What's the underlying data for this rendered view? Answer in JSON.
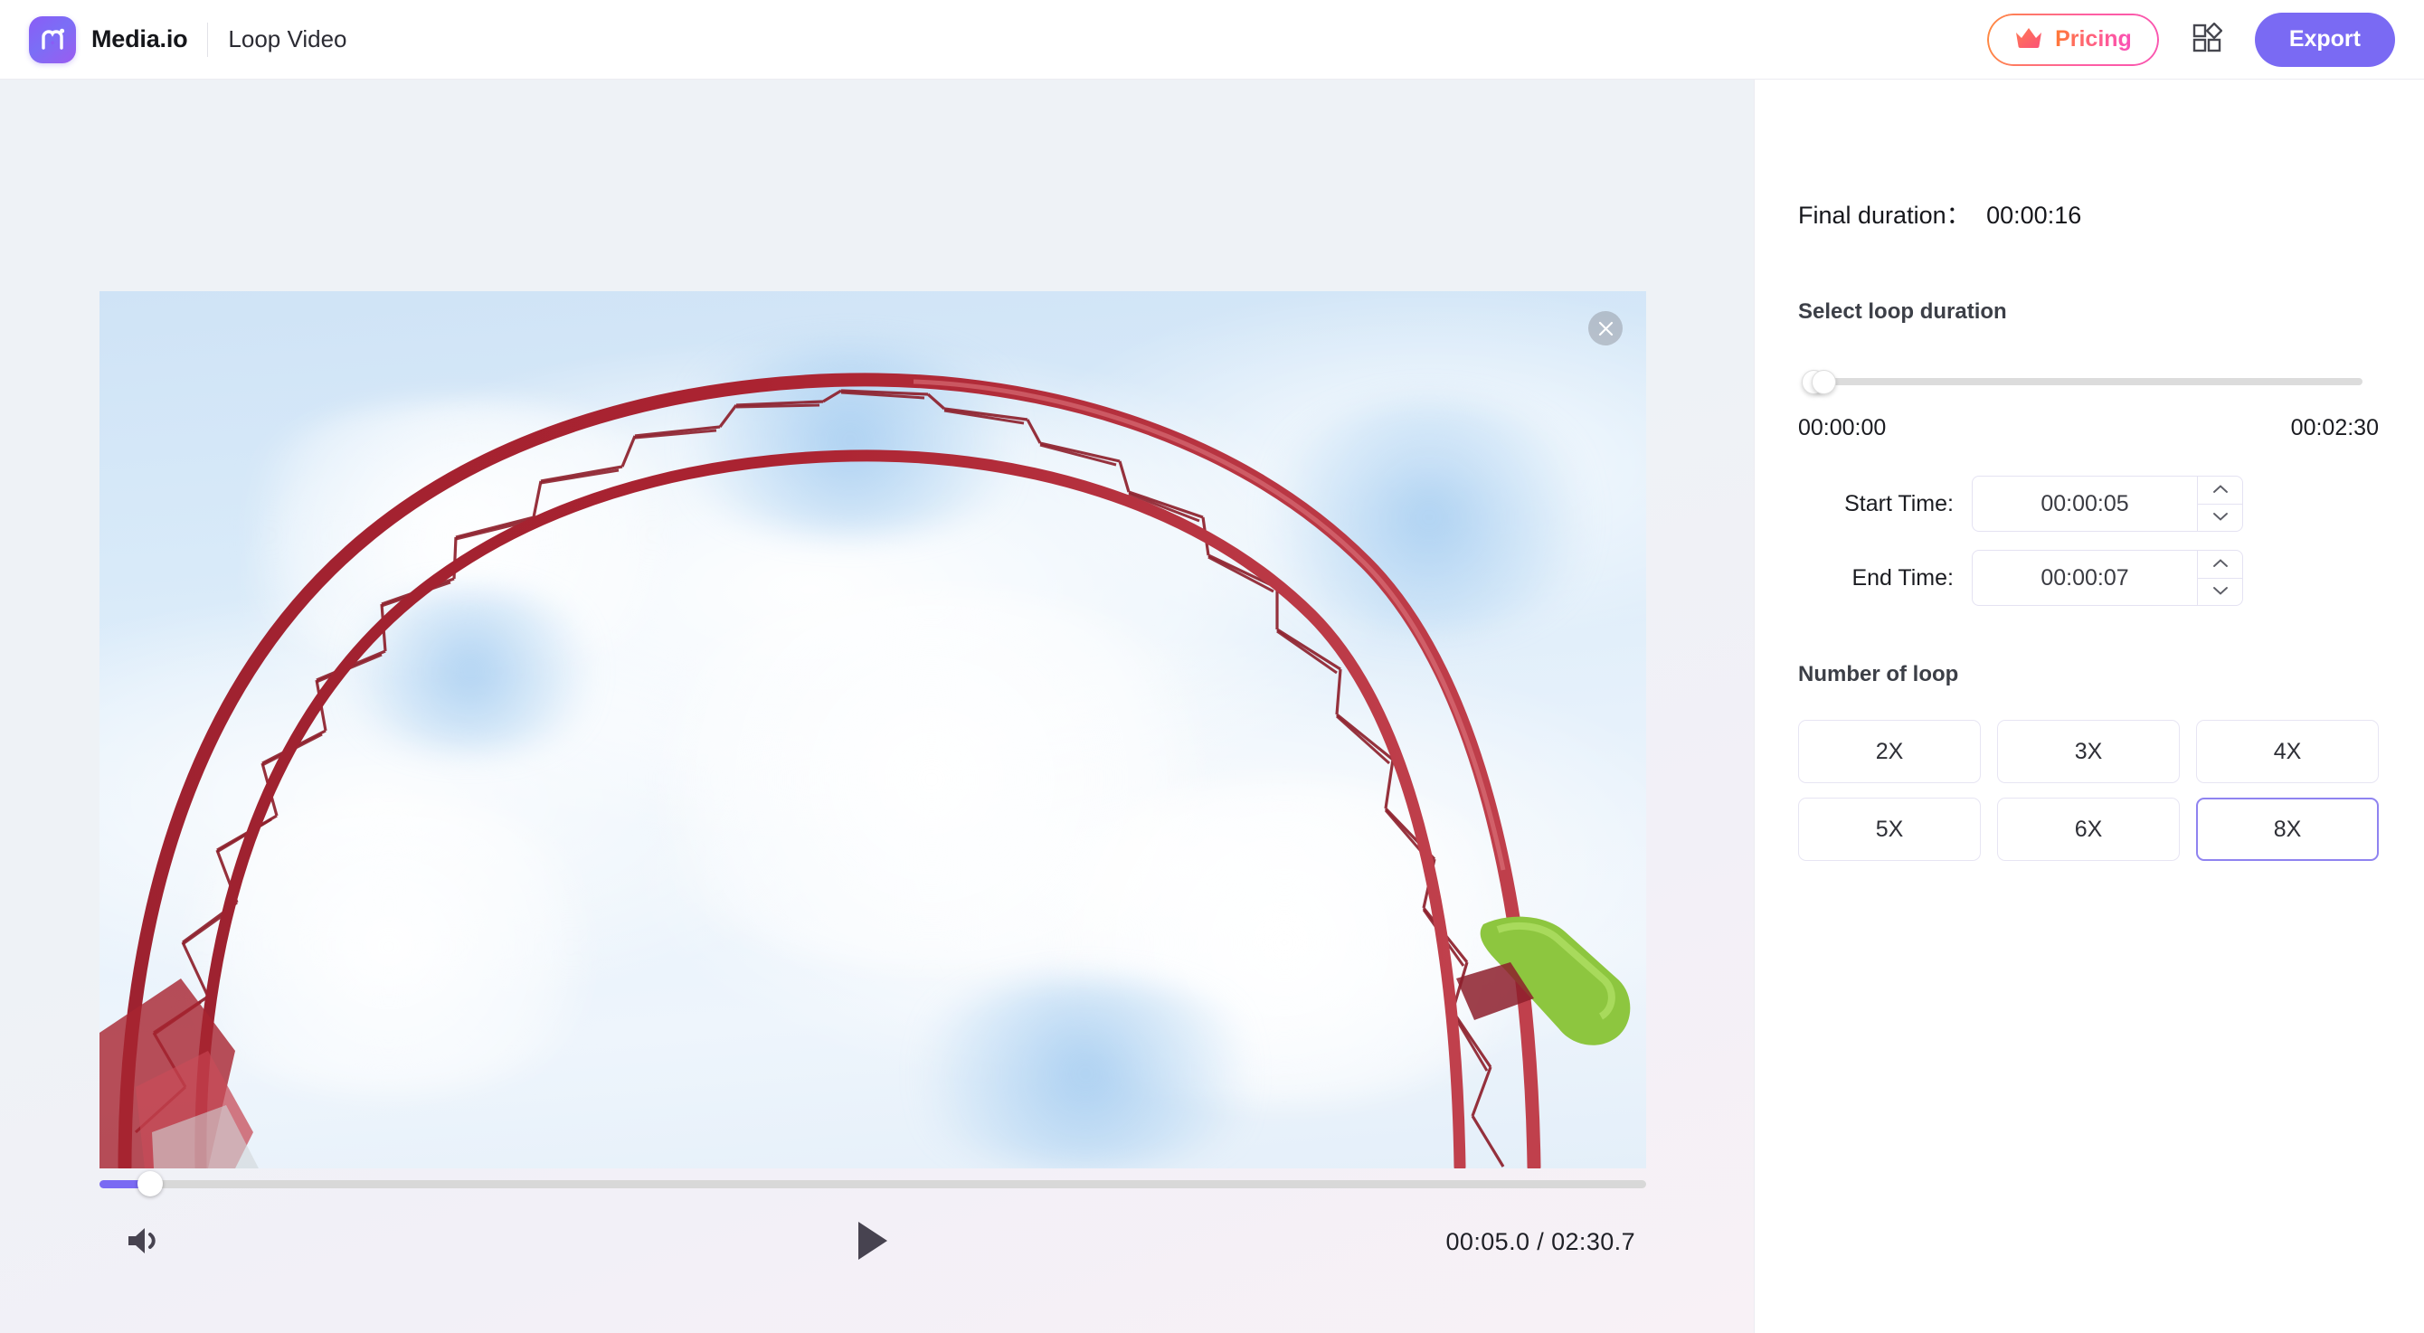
{
  "header": {
    "logo_icon": "media-io-logo-icon",
    "brand_name": "Media.io",
    "tool_title": "Loop Video",
    "pricing_label": "Pricing",
    "pricing_icon": "crown-icon",
    "grid_icon": "apps-grid-icon",
    "export_label": "Export",
    "export_color": "#7a6af3",
    "pricing_gradient_start": "#ff7a33",
    "pricing_gradient_end": "#f94fbb"
  },
  "player": {
    "close_icon": "close-icon",
    "volume_icon": "volume-icon",
    "play_icon": "play-icon",
    "time_display": "00:05.0 / 02:30.7",
    "current_time": "00:05.0",
    "total_time": "02:30.7",
    "progress_percent": 3.3,
    "progress_fill_color": "#7a6af3",
    "video_description": "roller coaster loop against blue sky with clouds"
  },
  "panel": {
    "final_duration_label": "Final duration：",
    "final_duration_value": "00:00:16",
    "loop_duration_label": "Select loop duration",
    "range_start_label": "00:00:00",
    "range_end_label": "00:02:30",
    "start_time_label": "Start Time:",
    "start_time_value": "00:00:05",
    "end_time_label": "End Time:",
    "end_time_value": "00:00:07",
    "spin_up_icon": "chevron-up-icon",
    "spin_down_icon": "chevron-down-icon",
    "number_of_loop_label": "Number of loop",
    "loop_options": [
      {
        "label": "2X",
        "selected": false
      },
      {
        "label": "3X",
        "selected": false
      },
      {
        "label": "4X",
        "selected": false
      },
      {
        "label": "5X",
        "selected": false
      },
      {
        "label": "6X",
        "selected": false
      },
      {
        "label": "8X",
        "selected": true
      }
    ],
    "selected_loop": "8X",
    "selected_border_color": "#8f83f0"
  }
}
